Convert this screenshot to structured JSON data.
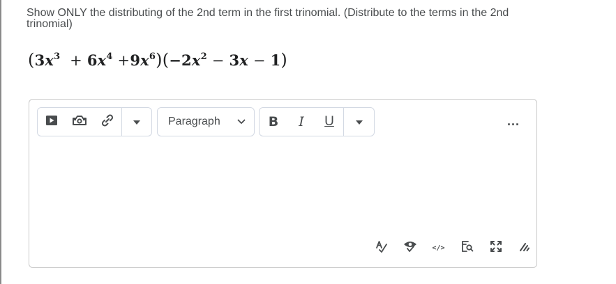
{
  "question": {
    "text": "Show ONLY the distributing of the 2nd term in the first trinomial. (Distribute to the terms in the 2nd trinomial)"
  },
  "equation": {
    "first_trinomial": {
      "t1": {
        "coef": "3",
        "var": "x",
        "exp": "3"
      },
      "op1": "+",
      "t2": {
        "coef": "6",
        "var": "x",
        "exp": "4"
      },
      "op2": "+",
      "t3": {
        "coef": "9",
        "var": "x",
        "exp": "6"
      }
    },
    "second_trinomial": {
      "t1": {
        "coef": "−2",
        "var": "x",
        "exp": "2"
      },
      "op1": "−",
      "t2": {
        "coef": "3",
        "var": "x"
      },
      "op2": "−",
      "t3": "1"
    }
  },
  "editor": {
    "toolbar": {
      "insert_quicklink_icon": "play-box-icon",
      "insert_image_icon": "camera-icon",
      "insert_link_icon": "link-icon",
      "more_insert_icon": "triangle-down-icon",
      "block_format": "Paragraph",
      "bold_label": "B",
      "italic_label": "I",
      "underline_label": "U",
      "more_format_icon": "triangle-down-icon",
      "more_actions_label": "..."
    },
    "bottom_toolbar": {
      "spellcheck_icon": "spellcheck-icon",
      "accessibility_icon": "eye-check-icon",
      "source_code_label": "</>",
      "preview_icon": "preview-icon",
      "fullscreen_icon": "fullscreen-icon",
      "resize_icon": "resize-handle-icon"
    },
    "content": ""
  }
}
